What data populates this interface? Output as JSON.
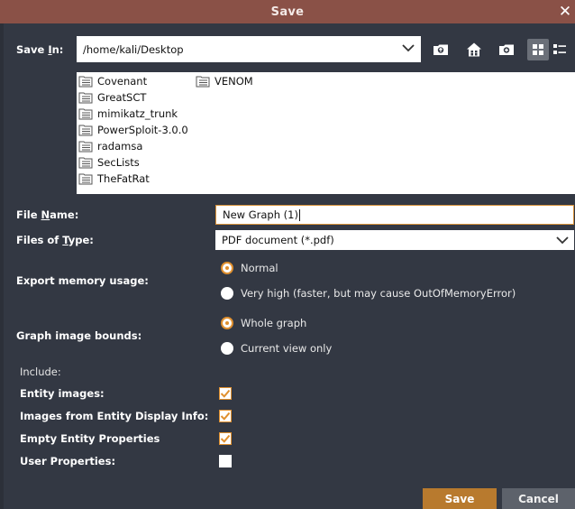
{
  "window": {
    "title": "Save",
    "close_label": "✕"
  },
  "save_in": {
    "label_prefix": "Save ",
    "label_mnemonic": "I",
    "label_suffix": "n:",
    "path": "/home/kali/Desktop"
  },
  "toolbar": {
    "icons": [
      "up-folder-icon",
      "home-icon",
      "new-folder-icon",
      "list-view-icon",
      "details-view-icon"
    ]
  },
  "files": [
    {
      "name": "Covenant"
    },
    {
      "name": "GreatSCT"
    },
    {
      "name": "mimikatz_trunk"
    },
    {
      "name": "PowerSploit-3.0.0"
    },
    {
      "name": "radamsa"
    },
    {
      "name": "SecLists"
    },
    {
      "name": "TheFatRat"
    },
    {
      "name": "VENOM"
    }
  ],
  "file_name": {
    "label_prefix": "File ",
    "label_mnemonic": "N",
    "label_suffix": "ame:",
    "value": "New Graph (1)"
  },
  "file_type": {
    "label_prefix": "Files of ",
    "label_mnemonic": "T",
    "label_suffix": "ype:",
    "value": "PDF document (*.pdf)"
  },
  "export_memory": {
    "label": "Export memory usage:",
    "options": [
      {
        "label": "Normal",
        "selected": true
      },
      {
        "label": "Very high (faster, but may cause OutOfMemoryError)",
        "selected": false
      }
    ]
  },
  "image_bounds": {
    "label": "Graph image bounds:",
    "options": [
      {
        "label": "Whole graph",
        "selected": true
      },
      {
        "label": "Current view only",
        "selected": false
      }
    ]
  },
  "include": {
    "label": "Include:",
    "items": [
      {
        "label": "Entity images:",
        "checked": true
      },
      {
        "label": "Images from Entity Display Info:",
        "checked": true
      },
      {
        "label": "Empty Entity Properties",
        "checked": true
      },
      {
        "label": "User Properties:",
        "checked": false
      }
    ]
  },
  "buttons": {
    "save": "Save",
    "cancel": "Cancel"
  },
  "colors": {
    "titlebar": "#8a5147",
    "background": "#333843",
    "accent": "#e0902f",
    "save_button": "#b87a2e",
    "cancel_button": "#5d626b"
  }
}
